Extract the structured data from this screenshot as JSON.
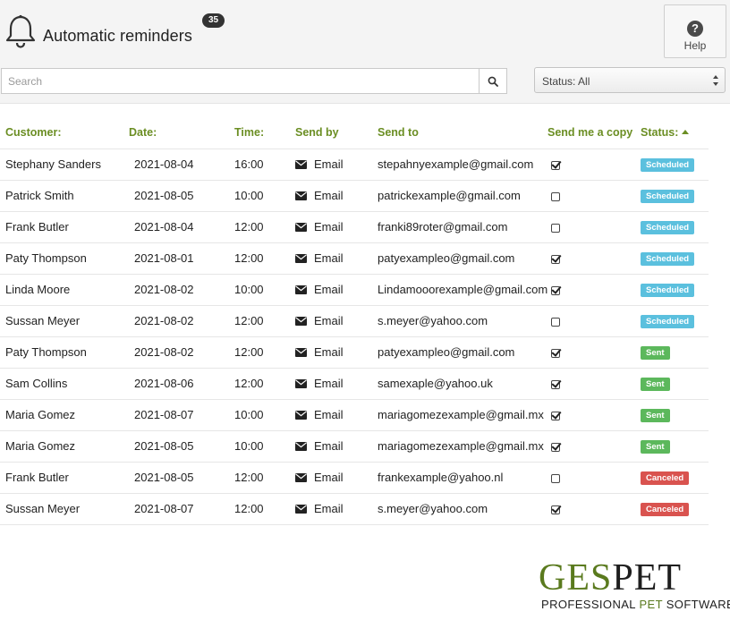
{
  "header": {
    "title": "Automatic reminders",
    "count": "35",
    "help_label": "Help",
    "help_glyph": "?"
  },
  "search": {
    "placeholder": "Search",
    "value": ""
  },
  "status_filter": {
    "selected": "Status:  All"
  },
  "columns": {
    "customer": "Customer:",
    "date": "Date:",
    "time": "Time:",
    "send_by": "Send by",
    "send_to": "Send to",
    "copy": "Send me a copy",
    "status": "Status:"
  },
  "rows": [
    {
      "customer": "Stephany Sanders",
      "date": "2021-08-04",
      "time": "16:00",
      "send_by": "Email",
      "send_to": "stepahnyexample@gmail.com",
      "copy": true,
      "status": "Scheduled"
    },
    {
      "customer": "Patrick Smith",
      "date": "2021-08-05",
      "time": "10:00",
      "send_by": "Email",
      "send_to": "patrickexample@gmail.com",
      "copy": false,
      "status": "Scheduled"
    },
    {
      "customer": "Frank Butler",
      "date": "2021-08-04",
      "time": "12:00",
      "send_by": "Email",
      "send_to": "franki89roter@gmail.com",
      "copy": false,
      "status": "Scheduled"
    },
    {
      "customer": "Paty Thompson",
      "date": "2021-08-01",
      "time": "12:00",
      "send_by": "Email",
      "send_to": "patyexampleo@gmail.com",
      "copy": true,
      "status": "Scheduled"
    },
    {
      "customer": "Linda Moore",
      "date": "2021-08-02",
      "time": "10:00",
      "send_by": "Email",
      "send_to": "Lindamooorexample@gmail.com",
      "copy": true,
      "status": "Scheduled"
    },
    {
      "customer": "Sussan Meyer",
      "date": "2021-08-02",
      "time": "12:00",
      "send_by": "Email",
      "send_to": "s.meyer@yahoo.com",
      "copy": false,
      "status": "Scheduled"
    },
    {
      "customer": "Paty Thompson",
      "date": "2021-08-02",
      "time": "12:00",
      "send_by": "Email",
      "send_to": "patyexampleo@gmail.com",
      "copy": true,
      "status": "Sent"
    },
    {
      "customer": "Sam Collins",
      "date": "2021-08-06",
      "time": "12:00",
      "send_by": "Email",
      "send_to": "samexaple@yahoo.uk",
      "copy": true,
      "status": "Sent"
    },
    {
      "customer": "Maria Gomez",
      "date": "2021-08-07",
      "time": "10:00",
      "send_by": "Email",
      "send_to": "mariagomezexample@gmail.mx",
      "copy": true,
      "status": "Sent"
    },
    {
      "customer": "Maria Gomez",
      "date": "2021-08-05",
      "time": "10:00",
      "send_by": "Email",
      "send_to": "mariagomezexample@gmail.mx",
      "copy": true,
      "status": "Sent"
    },
    {
      "customer": "Frank Butler",
      "date": "2021-08-05",
      "time": "12:00",
      "send_by": "Email",
      "send_to": "frankexample@yahoo.nl",
      "copy": false,
      "status": "Canceled"
    },
    {
      "customer": "Sussan Meyer",
      "date": "2021-08-07",
      "time": "12:00",
      "send_by": "Email",
      "send_to": "s.meyer@yahoo.com",
      "copy": true,
      "status": "Canceled"
    }
  ],
  "logo": {
    "main_ges": "GES",
    "main_pet": "PET",
    "sub_professional": "PROFESSIONAL ",
    "sub_pet": "PET",
    "sub_software": " SOFTWARE"
  },
  "icons": {
    "bell": "bell-icon",
    "help": "help-icon",
    "search": "search-icon",
    "mail": "envelope-icon",
    "select": "select-arrows-icon",
    "sort": "sort-up-icon"
  },
  "colors": {
    "accent_green": "#6b8e23",
    "scheduled": "#5bc0de",
    "sent": "#5cb85c",
    "canceled": "#d9534f"
  }
}
